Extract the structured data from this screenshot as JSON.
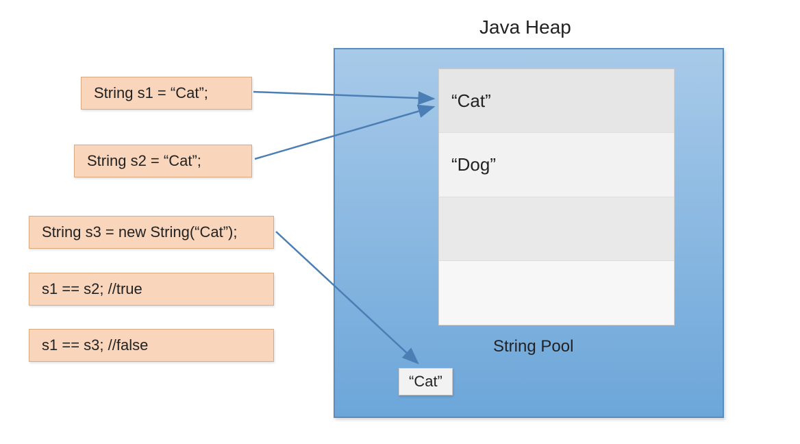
{
  "heap_title": "Java Heap",
  "string_pool_label": "String Pool",
  "pool_entries": [
    "“Cat”",
    "“Dog”",
    "",
    ""
  ],
  "heap_object": "“Cat”",
  "code_boxes": {
    "s1": "String s1 = “Cat”;",
    "s2": "String s2 = “Cat”;",
    "s3": "String s3 = new String(“Cat”);",
    "cmp1": "s1 == s2; //true",
    "cmp2": "s1 == s3; //false"
  }
}
